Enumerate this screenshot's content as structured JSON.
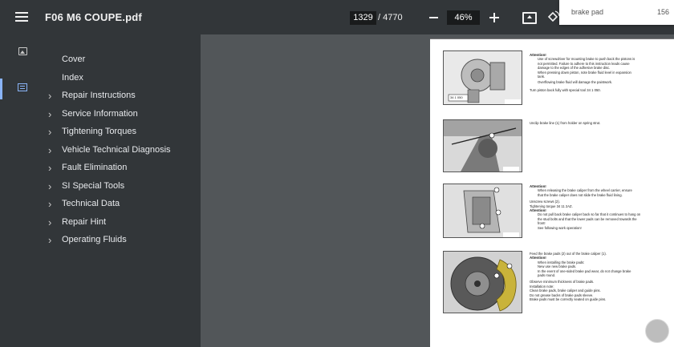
{
  "toolbar": {
    "file_name": "F06 M6 COUPE.pdf",
    "current_page": "1329",
    "page_total": "/ 4770",
    "zoom": "46%"
  },
  "search_popup": {
    "label": "brake pad",
    "page": "156"
  },
  "sidebar": {
    "outline": [
      {
        "label": "Cover",
        "expandable": false
      },
      {
        "label": "Index",
        "expandable": false
      },
      {
        "label": "Repair Instructions",
        "expandable": true
      },
      {
        "label": "Service Information",
        "expandable": true
      },
      {
        "label": "Tightening Torques",
        "expandable": true
      },
      {
        "label": "Vehicle Technical Diagnosis",
        "expandable": true
      },
      {
        "label": "Fault Elimination",
        "expandable": true
      },
      {
        "label": "SI Special Tools",
        "expandable": true
      },
      {
        "label": "Technical Data",
        "expandable": true
      },
      {
        "label": "Repair Hint",
        "expandable": true
      },
      {
        "label": "Operating Fluids",
        "expandable": true
      }
    ]
  },
  "document": {
    "block1": {
      "heading": "Attention!",
      "lines": [
        "Use of screwdriver for mounting brake to push back the pistons is",
        "not permitted. Failure to adhere to this instruction leads cause",
        "damage to the edges of the adhesive brake disc.",
        "When pressing down piston, note brake fluid level in expansion",
        "tank.",
        "Overflowing brake fluid will damage the paintwork."
      ],
      "footer": "Turn piston back fully with special tool 34 1 050.",
      "tag": "34 1 050"
    },
    "block2": {
      "lines": [
        "Unclip brake line (1) from holder on spring strut."
      ]
    },
    "block3": {
      "heading": "Attention!",
      "lines": [
        "When releasing the brake caliper from the wheel carrier, ensure",
        "that the brake caliper does not slide the brake fluid lining.",
        "",
        "Unscrew screws (2).",
        "Tightening torque 34 11 2AZ."
      ],
      "heading2": "Attention!",
      "lines2": [
        "Do not pull back brake caliper back so far that it continues to hang on",
        "the stud bolts and that the lower pads can be removed towards the",
        "front!",
        "See following work operation!"
      ]
    },
    "block4": {
      "intro": "Feed the brake pads (2) out of the brake caliper (1).",
      "heading": "Attention!",
      "lines": [
        "When installing the brake pads:",
        "New use new brake pads.",
        "In the event of one-sided brake pad wear, do not change brake",
        "pads round.",
        "",
        "Observe minimum thickness of brake pads.",
        "Installation note:",
        "Clean brake pads, brake caliper and guide pins.",
        "Do not grease backs of brake pads sleeve.",
        "Brake pads must be correctly seated on guide pins."
      ]
    }
  },
  "colors": {
    "toolbar_bg": "#323639",
    "viewer_bg": "#525659",
    "accent": "#8ab4f8",
    "caliper": "#c9b33a"
  }
}
